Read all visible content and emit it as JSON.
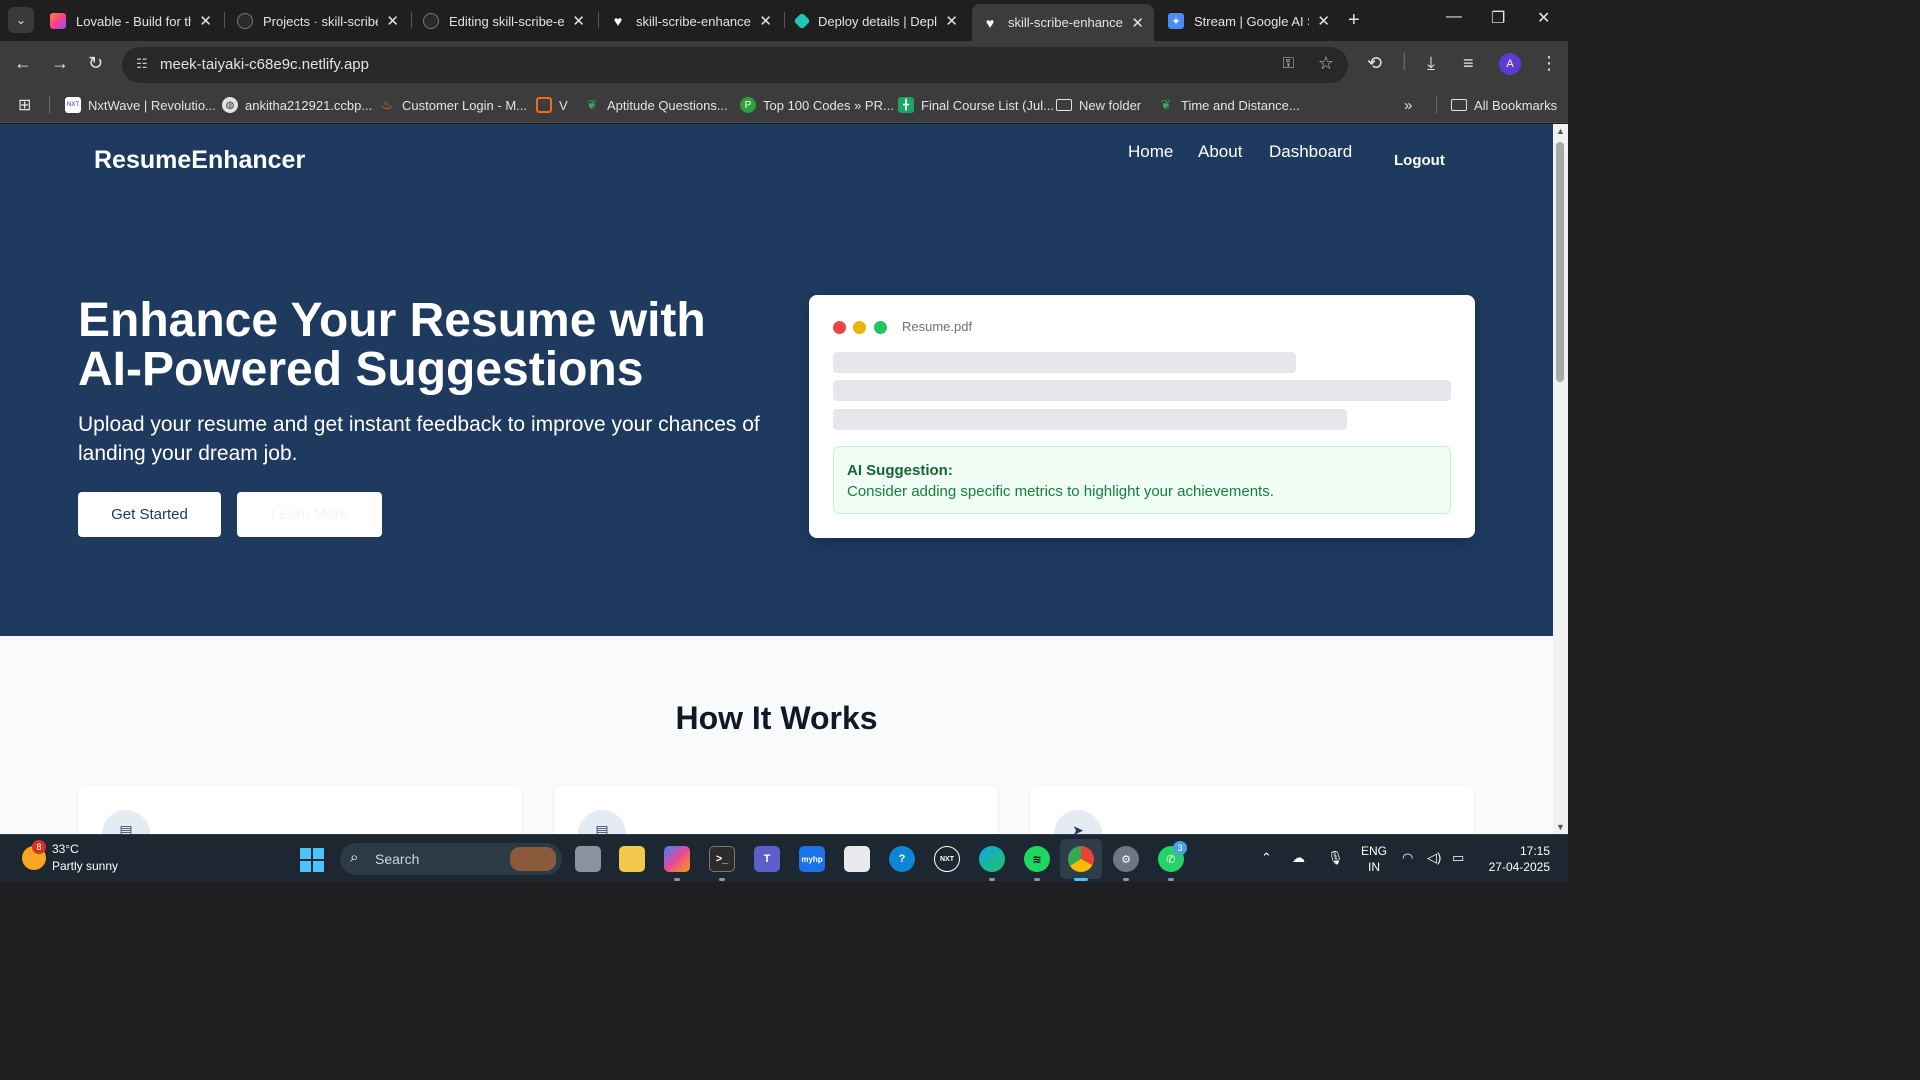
{
  "browser": {
    "tabs": [
      {
        "title": "Lovable - Build for th",
        "favicon": "lovable-icon",
        "color": "#ff5a7a"
      },
      {
        "title": "Projects · skill-scribe-",
        "favicon": "github-icon",
        "color": "#2a2a2a"
      },
      {
        "title": "Editing skill-scribe-en",
        "favicon": "github-icon",
        "color": "#2a2a2a"
      },
      {
        "title": "skill-scribe-enhance",
        "favicon": "heart-icon",
        "color": "#ffffff"
      },
      {
        "title": "Deploy details | Depl",
        "favicon": "netlify-icon",
        "color": "#20c5b5"
      },
      {
        "title": "skill-scribe-enhance",
        "favicon": "heart-icon",
        "color": "#ffffff"
      },
      {
        "title": "Stream | Google AI St",
        "favicon": "google-ai-icon",
        "color": "#4a8cf7"
      }
    ],
    "active_tab_index": 5,
    "url": "meek-taiyaki-c68e9c.netlify.app",
    "profile_initial": "A",
    "bookmarks": [
      {
        "label": "NxtWave | Revolutio...",
        "icon": "nxtwave-icon",
        "color": "#ffffff"
      },
      {
        "label": "ankitha212921.ccbp...",
        "icon": "globe-icon",
        "color": "#e3e3e3"
      },
      {
        "label": "Customer Login - M...",
        "icon": "flame-icon",
        "color": "#f26b1d"
      },
      {
        "label": "V",
        "icon": "chat-icon",
        "color": "#f26b1d"
      },
      {
        "label": "Aptitude Questions...",
        "icon": "leaf-icon",
        "color": "#3aa757"
      },
      {
        "label": "Top 100 Codes » PR...",
        "icon": "shield-icon",
        "color": "#2e9e3f"
      },
      {
        "label": "Final Course List (Jul...",
        "icon": "sheets-icon",
        "color": "#1fa463"
      },
      {
        "label": "New folder",
        "icon": "folder-icon",
        "color": "#e3e3e3"
      },
      {
        "label": "Time and Distance...",
        "icon": "leaf-icon",
        "color": "#3aa757"
      }
    ],
    "all_bookmarks_label": "All Bookmarks"
  },
  "page": {
    "brand": "ResumeEnhancer",
    "nav": {
      "home": "Home",
      "about": "About",
      "dashboard": "Dashboard",
      "logout": "Logout"
    },
    "hero": {
      "title": "Enhance Your Resume with AI-Powered Suggestions",
      "subtitle": "Upload your resume and get instant feedback to improve your chances of landing your dream job.",
      "primary_button": "Get Started",
      "secondary_button": "Learn More"
    },
    "preview": {
      "filename": "Resume.pdf",
      "suggestion_title": "AI Suggestion:",
      "suggestion_text": "Consider adding specific metrics to highlight your achievements."
    },
    "how_it_works_title": "How It Works",
    "colors": {
      "hero_bg": "#1e3a5f",
      "suggestion_bg": "#f0fdf4",
      "suggestion_text": "#15803d"
    }
  },
  "taskbar": {
    "weather_temp": "33°C",
    "weather_desc": "Partly sunny",
    "weather_badge": "8",
    "search_placeholder": "Search",
    "teams_badge": "",
    "whatsapp_badge": "3",
    "lang_top": "ENG",
    "lang_bottom": "IN",
    "time": "17:15",
    "date": "27-04-2025"
  }
}
